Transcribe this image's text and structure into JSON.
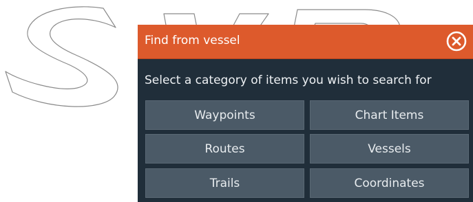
{
  "dialog": {
    "title": "Find from vessel",
    "prompt": "Select a category of items you wish to search for",
    "close_icon": "close-circle-icon",
    "accent_color": "#dd5a2c",
    "background_color": "#202e3a",
    "button_color": "#4b5a67"
  },
  "categories": [
    {
      "label": "Waypoints"
    },
    {
      "label": "Chart Items"
    },
    {
      "label": "Routes"
    },
    {
      "label": "Vessels"
    },
    {
      "label": "Trails"
    },
    {
      "label": "Coordinates"
    }
  ],
  "watermark": {
    "text": "SVB"
  }
}
